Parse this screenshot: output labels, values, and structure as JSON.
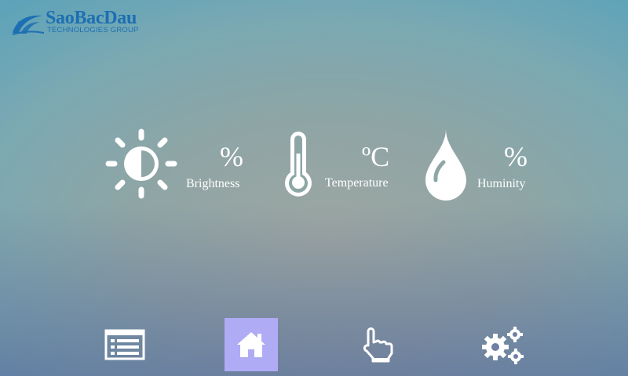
{
  "brand": {
    "name": "SaoBacDau",
    "subtitle": "TECHNOLOGIES GROUP",
    "color": "#1c6fb3"
  },
  "sensors": [
    {
      "id": "brightness",
      "icon": "sun-icon",
      "unit": "%",
      "label": "Brightness"
    },
    {
      "id": "temperature",
      "icon": "thermometer-icon",
      "unit": "ºC",
      "label": "Temperature"
    },
    {
      "id": "humidity",
      "icon": "water-drop-icon",
      "unit": "%",
      "label": "Huminity"
    }
  ],
  "nav": [
    {
      "id": "list",
      "icon": "list-icon",
      "active": false
    },
    {
      "id": "home",
      "icon": "home-icon",
      "active": true
    },
    {
      "id": "touch",
      "icon": "touch-hand-icon",
      "active": false
    },
    {
      "id": "settings",
      "icon": "gears-icon",
      "active": false
    }
  ],
  "colors": {
    "active_nav": "#b0abf5",
    "icon": "#ffffff"
  }
}
